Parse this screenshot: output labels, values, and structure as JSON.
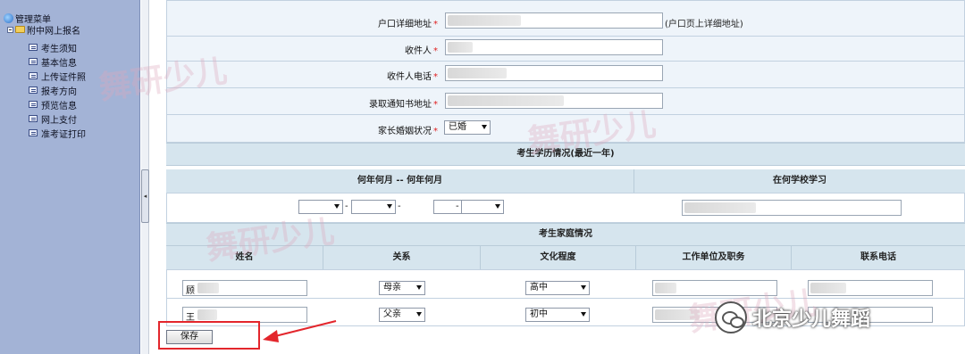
{
  "sidebar": {
    "root_label": "管理菜单",
    "folder_label": "附中网上报名",
    "items": [
      {
        "label": "考生须知"
      },
      {
        "label": "基本信息"
      },
      {
        "label": "上传证件照"
      },
      {
        "label": "报考方向"
      },
      {
        "label": "预览信息"
      },
      {
        "label": "网上支付"
      },
      {
        "label": "准考证打印"
      }
    ]
  },
  "form": {
    "address_label": "户口详细地址",
    "address_hint": "(户口页上详细地址)",
    "recipient_label": "收件人",
    "recipient_phone_label": "收件人电话",
    "notice_address_label": "录取通知书地址",
    "marital_label": "家长婚姻状况",
    "marital_value": "已婚",
    "required_mark": "*"
  },
  "education": {
    "section_title": "考生学历情况(最近一年)",
    "period_header": "何年何月 -- 何年何月",
    "school_header": "在何学校学习",
    "dash": "-"
  },
  "family": {
    "section_title": "考生家庭情况",
    "columns": [
      "姓名",
      "关系",
      "文化程度",
      "工作单位及职务",
      "联系电话"
    ],
    "rows": [
      {
        "name": "顾",
        "relation": "母亲",
        "education": "高中"
      },
      {
        "name": "王",
        "relation": "父亲",
        "education": "初中"
      }
    ]
  },
  "actions": {
    "save_label": "保存"
  },
  "watermarks": {
    "brand": "舞研少儿",
    "wechat": "北京少儿舞蹈"
  },
  "colors": {
    "sidebar_bg": "#a3b3d6",
    "section_header_bg": "#d6e5ee",
    "annotation_red": "#e3262c"
  }
}
